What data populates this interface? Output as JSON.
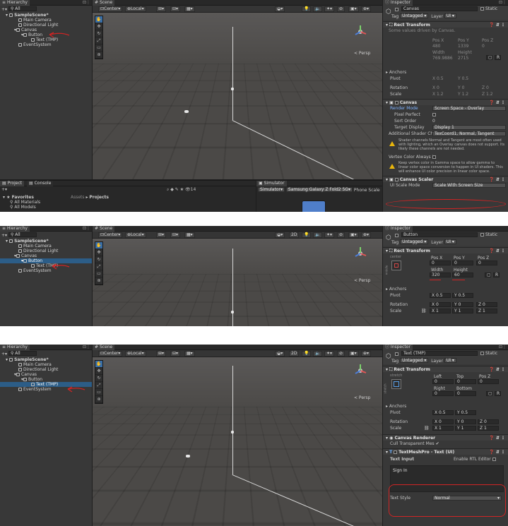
{
  "shots": [
    {
      "hierarchy": {
        "tab": "Hierarchy",
        "search": "All",
        "items": [
          "SampleScene*",
          "Main Camera",
          "Directional Light",
          "Canvas",
          "Button",
          "Text (TMP)",
          "EventSystem"
        ]
      },
      "scene": {
        "tab": "Scene",
        "pivot": "Center",
        "space": "Local",
        "persp": "< Persp"
      },
      "bottom": {
        "tab1": "Project",
        "tab2": "Console",
        "sim_tab": "Simulator",
        "sim_label": "Simulator",
        "device": "Samsung Galaxy Z Fold2 5G",
        "phone": "Phone",
        "scale": "Scale",
        "hidden_count": "14",
        "favorites": "Favorites",
        "fav_items": [
          "All Materials",
          "All Models"
        ],
        "assets_path": "Assets",
        "projects_path": "Projects"
      },
      "inspector": {
        "tab": "Inspector",
        "object": "Canvas",
        "static": "Static",
        "tag_label": "Tag",
        "tag": "Untagged",
        "layer_label": "Layer",
        "layer": "UI",
        "rect_title": "Rect Transform",
        "driven_note": "Some values driven by Canvas.",
        "pos_x_label": "Pos X",
        "pos_y_label": "Pos Y",
        "pos_z_label": "Pos Z",
        "pos_x": "480",
        "pos_y": "1339",
        "pos_z": "0",
        "width_label": "Width",
        "height_label": "Height",
        "width": "769.9886",
        "height": "2715",
        "anchors": "Anchors",
        "pivot_label": "Pivot",
        "pivot_x": "X 0.5",
        "pivot_y": "Y 0.5",
        "rotation_label": "Rotation",
        "rot_x": "X 0",
        "rot_y": "Y 0",
        "rot_z": "Z 0",
        "scale_label": "Scale",
        "scale_x": "X 1.2",
        "scale_y": "Y 1.2",
        "scale_z": "Z 1.2",
        "canvas_title": "Canvas",
        "render_mode_label": "Render Mode",
        "render_mode": "Screen Space - Overlay",
        "pixel_perfect": "Pixel Perfect",
        "sort_order_label": "Sort Order",
        "sort_order": "0",
        "target_display_label": "Target Display",
        "target_display": "Display 1",
        "shader_label": "Additional Shader Ch",
        "shader_value": "TexCoord1, Normal, Tangent",
        "warn1": "Shader channels Normal and Tangent are most often used with lighting, which an Overlay canvas does not support. Its likely these channels are not needed.",
        "vertex_color": "Vertex Color Always I",
        "warn2": "Keep vertex color in Gamma space to allow gamma to linear color space conversion to happen in UI shaders. This will enhance UI color precision in linear color space.",
        "scaler_title": "Canvas Scaler",
        "ui_scale_label": "UI Scale Mode",
        "ui_scale": "Scale With Screen Size"
      }
    },
    {
      "hierarchy": {
        "tab": "Hierarchy",
        "search": "All",
        "items": [
          "SampleScene*",
          "Main Camera",
          "Directional Light",
          "Canvas",
          "Button",
          "Text (TMP)",
          "EventSystem"
        ]
      },
      "scene": {
        "tab": "Scene",
        "pivot": "Center",
        "space": "Local",
        "persp": "< Persp",
        "mode2d": "2D"
      },
      "inspector": {
        "tab": "Inspector",
        "object": "Button",
        "static": "Static",
        "tag_label": "Tag",
        "tag": "Untagged",
        "layer_label": "Layer",
        "layer": "UI",
        "rect_title": "Rect Transform",
        "anchor_preset": "center",
        "side_label": "middle",
        "pos_x_label": "Pos X",
        "pos_y_label": "Pos Y",
        "pos_z_label": "Pos Z",
        "pos_x": "0",
        "pos_y": "0",
        "pos_z": "0",
        "width_label": "Width",
        "height_label": "Height",
        "width": "320",
        "height": "60",
        "anchors": "Anchors",
        "pivot_label": "Pivot",
        "pivot_x": "X 0.5",
        "pivot_y": "Y 0.5",
        "rotation_label": "Rotation",
        "rot_x": "X 0",
        "rot_y": "Y 0",
        "rot_z": "Z 0",
        "scale_label": "Scale",
        "scale_x": "X 1",
        "scale_y": "Y 1",
        "scale_z": "Z 1"
      }
    },
    {
      "hierarchy": {
        "tab": "Hierarchy",
        "search": "All",
        "items": [
          "SampleScene*",
          "Main Camera",
          "Directional Light",
          "Canvas",
          "Button",
          "Text (TMP)",
          "EventSystem"
        ]
      },
      "scene": {
        "tab": "Scene",
        "pivot": "Center",
        "space": "Local",
        "persp": "< Persp",
        "mode2d": "2D"
      },
      "inspector": {
        "tab": "Inspector",
        "object": "Text (TMP)",
        "static": "Static",
        "tag_label": "Tag",
        "tag": "Untagged",
        "layer_label": "Layer",
        "layer": "UI",
        "rect_title": "Rect Transform",
        "anchor_preset": "stretch",
        "side_label": "stretch",
        "left_label": "Left",
        "top_label": "Top",
        "posz_label": "Pos Z",
        "left": "0",
        "top": "0",
        "pos_z": "0",
        "right_label": "Right",
        "bottom_label": "Bottom",
        "right": "0",
        "bottom": "0",
        "anchors": "Anchors",
        "pivot_label": "Pivot",
        "pivot_x": "X 0.5",
        "pivot_y": "Y 0.5",
        "rotation_label": "Rotation",
        "rot_x": "X 0",
        "rot_y": "Y 0",
        "rot_z": "Z 0",
        "scale_label": "Scale",
        "scale_x": "X 1",
        "scale_y": "Y 1",
        "scale_z": "Z 1",
        "renderer_title": "Canvas Renderer",
        "cull_label": "Cull Transparent Mes",
        "tmp_title": "TextMeshPro - Text (UI)",
        "text_input_label": "Text Input",
        "rtl_label": "Enable RTL Editor",
        "text_value": "Sign In",
        "text_style_label": "Text Style",
        "text_style": "Normal"
      }
    }
  ],
  "colors": {
    "selection": "#2c5d87",
    "annotation": "#d02424",
    "scene": "#4b4947",
    "panel": "#383838"
  }
}
